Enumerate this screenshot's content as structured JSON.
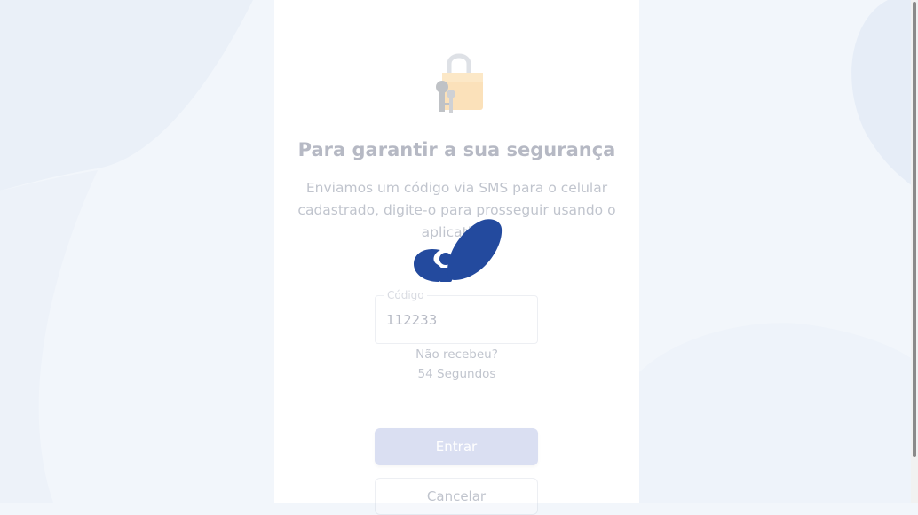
{
  "app": {
    "title": "Para garantir a sua segurança",
    "description": "Enviamos um código via SMS para o celular cadastrado, digite-o para prosseguir usando o aplicativo."
  },
  "code_field": {
    "label": "Código",
    "value": "112233"
  },
  "resend": {
    "text": "Não recebeu?",
    "countdown": "54 Segundos"
  },
  "buttons": {
    "enter": "Entrar",
    "cancel": "Cancelar"
  },
  "icons": {
    "lock": "lock-with-keys-icon",
    "logo": "app-logo-icon"
  },
  "colors": {
    "brand_blue": "#234a9e",
    "enter_button": "#8f9dd9",
    "background": "#f2f6fb"
  }
}
